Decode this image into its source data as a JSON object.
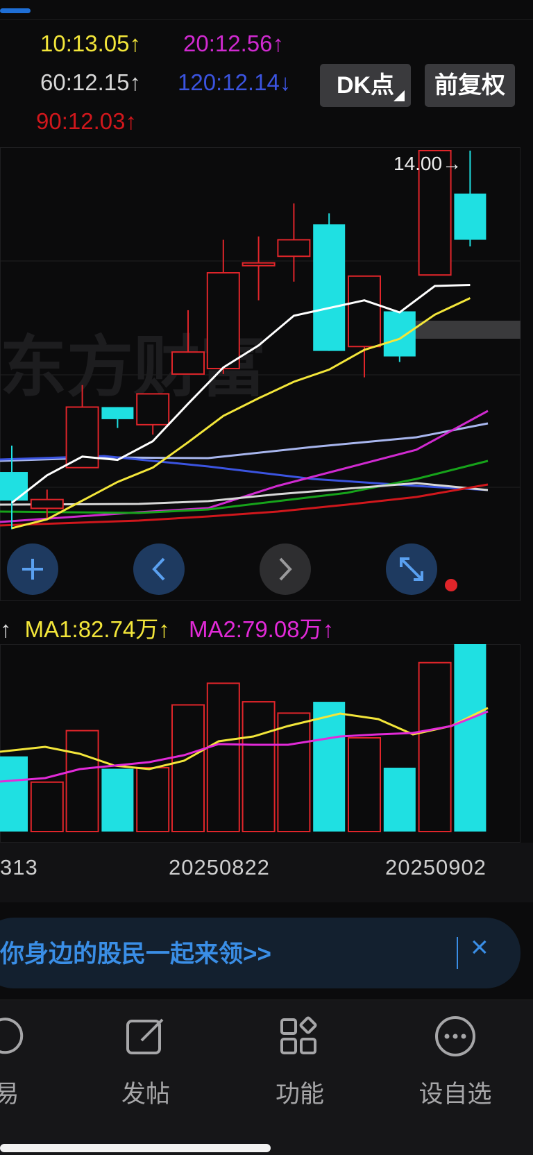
{
  "ma_indicators": [
    {
      "label": "10:13.05",
      "arrow": "↑",
      "color": "#f3e63a"
    },
    {
      "label": "20:12.56",
      "arrow": "↑",
      "color": "#d02ad0"
    },
    {
      "label": "60:12.15",
      "arrow": "↑",
      "color": "#d7d7d7"
    },
    {
      "label": "120:12.14",
      "arrow": "↓",
      "color": "#3b54e0"
    },
    {
      "label": "90:12.03",
      "arrow": "↑",
      "color": "#d0171c"
    }
  ],
  "buttons": {
    "dk_label": "DK点",
    "fuquan_label": "前复权"
  },
  "price_high_label": "14.00→",
  "watermark": "东方财富",
  "volume_legend": {
    "lead_arrow": "↑",
    "ma1": "MA1:82.74万",
    "ma1_arrow": "↑",
    "ma1_color": "#f3e63a",
    "ma2": "MA2:79.08万",
    "ma2_arrow": "↑",
    "ma2_color": "#e22ad8"
  },
  "dates": {
    "left": "313",
    "mid": "20250822",
    "right": "20250902"
  },
  "banner": {
    "text": "你身边的股民一起来领>>",
    "close": "×"
  },
  "tabbar": [
    {
      "label": "易",
      "icon": "trade-icon"
    },
    {
      "label": "发帖",
      "icon": "compose-icon"
    },
    {
      "label": "功能",
      "icon": "apps-icon"
    },
    {
      "label": "设自选",
      "icon": "more-icon"
    }
  ],
  "colors": {
    "up": "#e0252a",
    "down": "#1fe0e2",
    "ma10": "#ffffff",
    "ma20": "#f3e63a"
  },
  "chart_data": {
    "type": "candlestick",
    "candles": [
      {
        "open": 11.08,
        "close": 10.82,
        "high": 11.32,
        "low": 10.56
      },
      {
        "open": 10.75,
        "close": 10.83,
        "high": 10.92,
        "low": 10.66
      },
      {
        "open": 11.12,
        "close": 11.67,
        "high": 11.87,
        "low": 11.12
      },
      {
        "open": 11.67,
        "close": 11.56,
        "high": 11.67,
        "low": 11.48
      },
      {
        "open": 11.51,
        "close": 11.79,
        "high": 11.79,
        "low": 11.42
      },
      {
        "open": 11.97,
        "close": 12.17,
        "high": 12.55,
        "low": 11.97
      },
      {
        "open": 12.02,
        "close": 12.89,
        "high": 13.19,
        "low": 11.97
      },
      {
        "open": 12.98,
        "close": 12.98,
        "high": 13.22,
        "low": 12.64
      },
      {
        "open": 13.04,
        "close": 13.19,
        "high": 13.52,
        "low": 12.81
      },
      {
        "open": 13.33,
        "close": 12.18,
        "high": 13.43,
        "low": 12.18
      },
      {
        "open": 12.22,
        "close": 12.86,
        "high": 12.86,
        "low": 11.94
      },
      {
        "open": 12.54,
        "close": 12.13,
        "high": 12.54,
        "low": 12.08
      },
      {
        "open": 12.87,
        "close": 14.0,
        "high": 14.0,
        "low": 12.87
      },
      {
        "open": 13.61,
        "close": 13.19,
        "high": 14.0,
        "low": 13.13
      }
    ],
    "volume_bars": [
      {
        "value": 0.73,
        "dir": "down"
      },
      {
        "value": 0.48,
        "dir": "up"
      },
      {
        "value": 0.98,
        "dir": "up"
      },
      {
        "value": 0.61,
        "dir": "down"
      },
      {
        "value": 0.62,
        "dir": "up"
      },
      {
        "value": 1.23,
        "dir": "up"
      },
      {
        "value": 1.44,
        "dir": "up"
      },
      {
        "value": 1.26,
        "dir": "up"
      },
      {
        "value": 1.15,
        "dir": "up"
      },
      {
        "value": 1.26,
        "dir": "down"
      },
      {
        "value": 0.91,
        "dir": "up"
      },
      {
        "value": 0.62,
        "dir": "down"
      },
      {
        "value": 1.64,
        "dir": "up"
      },
      {
        "value": 1.82,
        "dir": "down"
      }
    ],
    "ma10": [
      10.8,
      11.05,
      11.22,
      11.19,
      11.36,
      11.7,
      12.03,
      12.23,
      12.5,
      12.57,
      12.64,
      12.53,
      12.77,
      12.78
    ],
    "ma20": [
      10.57,
      10.65,
      10.82,
      10.99,
      11.12,
      11.35,
      11.59,
      11.75,
      11.9,
      12.01,
      12.19,
      12.29,
      12.51,
      12.66
    ]
  }
}
